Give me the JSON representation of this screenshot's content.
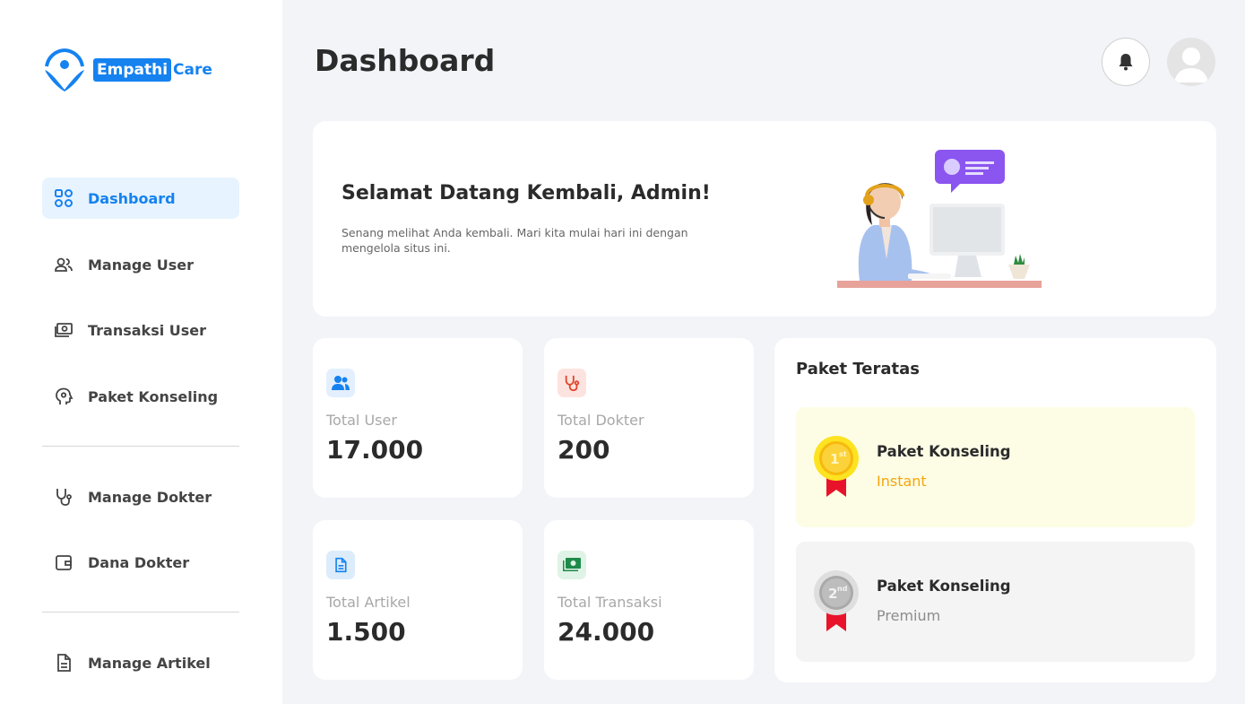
{
  "brand": {
    "part1": "Empathi",
    "part2": "Care",
    "color": "#1582f0"
  },
  "header": {
    "title": "Dashboard"
  },
  "sidebar": {
    "items": [
      {
        "label": "Dashboard",
        "icon": "dashboard-grid-icon",
        "active": true
      },
      {
        "label": "Manage User",
        "icon": "users-icon"
      },
      {
        "label": "Transaksi User",
        "icon": "money-icon"
      },
      {
        "label": "Paket Konseling",
        "icon": "head-gear-icon"
      },
      {
        "label": "Manage Dokter",
        "icon": "stethoscope-icon"
      },
      {
        "label": "Dana Dokter",
        "icon": "wallet-icon"
      },
      {
        "label": "Manage Artikel",
        "icon": "document-icon"
      }
    ]
  },
  "welcome": {
    "title": "Selamat Datang Kembali, Admin!",
    "subtitle": "Senang melihat Anda kembali. Mari kita mulai hari ini dengan mengelola situs ini."
  },
  "stats": [
    {
      "label": "Total User",
      "value": "17.000",
      "icon": "users-icon",
      "icon_bg": "#e3effd",
      "icon_color": "#1582f0"
    },
    {
      "label": "Total Dokter",
      "value": "200",
      "icon": "stethoscope-icon",
      "icon_bg": "#fde3df",
      "icon_color": "#e0452a"
    },
    {
      "label": "Total Artikel",
      "value": "1.500",
      "icon": "document-icon",
      "icon_bg": "#dcecfb",
      "icon_color": "#1582f0"
    },
    {
      "label": "Total Transaksi",
      "value": "24.000",
      "icon": "money-icon",
      "icon_bg": "#dff3e6",
      "icon_color": "#1e8a4a"
    }
  ],
  "top_packages": {
    "title": "Paket Teratas",
    "items": [
      {
        "name": "Paket Konseling",
        "type": "Instant",
        "rank": "1",
        "rank_suffix": "st",
        "bg": "#fdfde6",
        "type_color": "#f5a50a"
      },
      {
        "name": "Paket Konseling",
        "type": "Premium",
        "rank": "2",
        "rank_suffix": "nd",
        "bg": "#f4f4f4",
        "type_color": "#8c8c8c"
      }
    ]
  }
}
